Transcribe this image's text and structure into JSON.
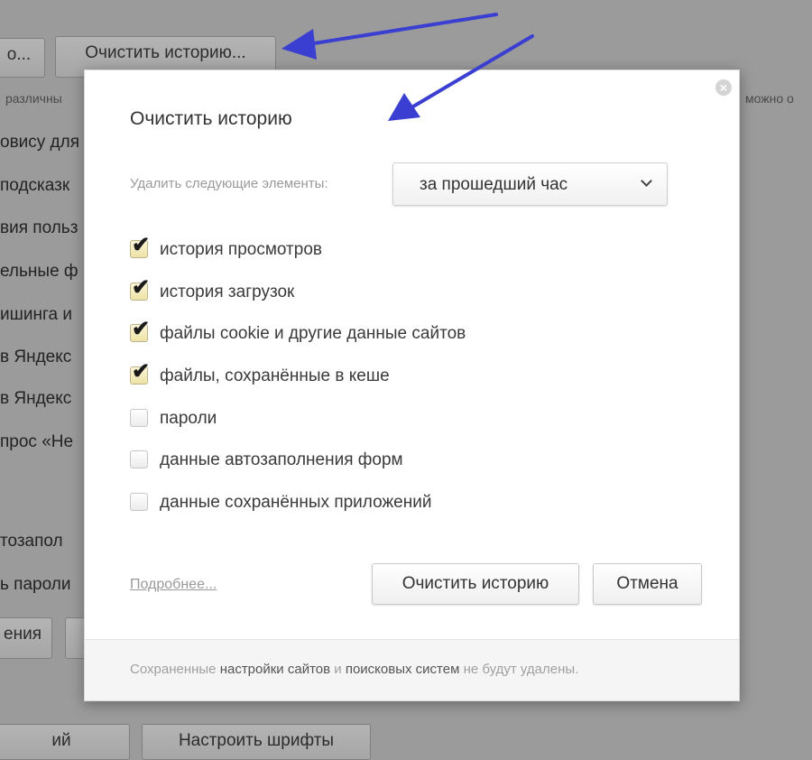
{
  "background": {
    "top_button_partial": "о...",
    "clear_history_button": "Очистить историю...",
    "side_text_top": "различны",
    "right_fragment": "можно о",
    "left_items": [
      "овису для",
      "подсказк",
      "вия польз",
      "ельные ф",
      "ишинга и",
      "в Яндекс",
      "в Яндекс",
      "прос «Не"
    ],
    "autofill_fragment": "тозапол",
    "passwords_fragment": "ь пароли",
    "bottom_button_left": "ения",
    "bottom_button_bottom_left": "ий",
    "bottom_button_bottom_right": "Настроить шрифты"
  },
  "dialog": {
    "close_symbol": "×",
    "title": "Очистить историю",
    "remove_label": "Удалить следующие элементы:",
    "period_select_value": "за прошедший час",
    "options": [
      {
        "label": "история просмотров",
        "checked": true
      },
      {
        "label": "история загрузок",
        "checked": true
      },
      {
        "label": "файлы cookie и другие данные сайтов",
        "checked": true
      },
      {
        "label": "файлы, сохранённые в кеше",
        "checked": true
      },
      {
        "label": "пароли",
        "checked": false
      },
      {
        "label": "данные автозаполнения форм",
        "checked": false
      },
      {
        "label": "данные сохранённых приложений",
        "checked": false
      }
    ],
    "more_link": "Подробнее...",
    "clear_button": "Очистить историю",
    "cancel_button": "Отмена",
    "footer": {
      "part1": "Сохраненные",
      "part2": "настройки сайтов",
      "part3": "и",
      "part4": "поисковых систем",
      "part5": "не будут удалены."
    }
  },
  "colors": {
    "arrow": "#3a3fd1",
    "dim_background": "#9b9b9b"
  }
}
